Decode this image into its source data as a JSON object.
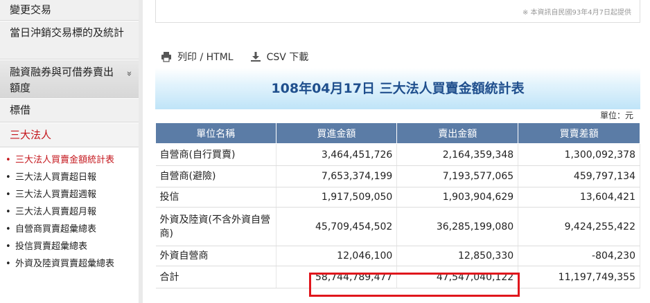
{
  "sidebar": {
    "items": [
      {
        "label": "變更交易"
      },
      {
        "label": "當日沖銷交易標的及統計"
      },
      {
        "label": "融資融券與可借券賣出額度",
        "chevron": "»"
      },
      {
        "label": "標借"
      },
      {
        "label": "三大法人"
      }
    ],
    "sub_items": [
      {
        "label": "三大法人買賣金額統計表"
      },
      {
        "label": "三大法人買賣超日報"
      },
      {
        "label": "三大法人買賣超週報"
      },
      {
        "label": "三大法人買賣超月報"
      },
      {
        "label": "自營商買賣超彙總表"
      },
      {
        "label": "投信買賣超彙總表"
      },
      {
        "label": "外資及陸資買賣超彙總表"
      }
    ],
    "bullet": "•"
  },
  "note": "※ 本資訊自民國93年4月7日起提供",
  "toolbar": {
    "print_label": "列印 / HTML",
    "csv_label": "CSV 下載",
    "print_icon": "printer-icon",
    "csv_icon": "download-icon"
  },
  "report": {
    "title": "108年04月17日 三大法人買賣金額統計表",
    "unit": "單位：元",
    "headers": [
      "單位名稱",
      "買進金額",
      "賣出金額",
      "買賣差額"
    ],
    "rows": [
      [
        "自營商(自行買賣)",
        "3,464,451,726",
        "2,164,359,348",
        "1,300,092,378"
      ],
      [
        "自營商(避險)",
        "7,653,374,199",
        "7,193,577,065",
        "459,797,134"
      ],
      [
        "投信",
        "1,917,509,050",
        "1,903,904,629",
        "13,604,421"
      ],
      [
        "外資及陸資(不含外資自營商)",
        "45,709,454,502",
        "36,285,199,080",
        "9,424,255,422"
      ],
      [
        "外資自營商",
        "12,046,100",
        "12,850,330",
        "-804,230"
      ],
      [
        "合計",
        "58,744,789,477",
        "47,547,040,122",
        "11,197,749,355"
      ]
    ]
  },
  "colors": {
    "accent_red": "#c4161c",
    "header_blue": "#5b7ca6",
    "title_blue": "#1f4f8d",
    "highlight_red": "#e0161c"
  }
}
